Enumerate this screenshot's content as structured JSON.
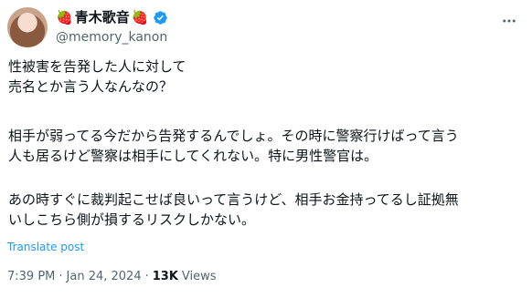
{
  "user": {
    "display_name": "青木歌音",
    "emoji_left": "🍓",
    "emoji_right": "🍓",
    "handle": "@memory_kanon",
    "verified_color": "#1d9bf0"
  },
  "tweet": {
    "paragraph1": "性被害を告発した人に対して\n売名とか言う人なんなの？",
    "paragraph2": "相手が弱ってる今だから告発するんでしょ。その時に警察行けばって言う\n人も居るけど警察は相手にしてくれない。特に男性警官は。",
    "paragraph3": "あの時すぐに裁判起こせば良いって言うけど、相手お金持ってるし証拠無\nいしこちら側が損するリスクしかない。",
    "translate_label": "Translate post"
  },
  "meta": {
    "time": "7:39 PM",
    "separator1": "·",
    "date": "Jan 24, 2024",
    "separator2": "·",
    "views_count": "13K",
    "views_label": "Views"
  },
  "menu": {
    "more_icon": "more-icon"
  }
}
